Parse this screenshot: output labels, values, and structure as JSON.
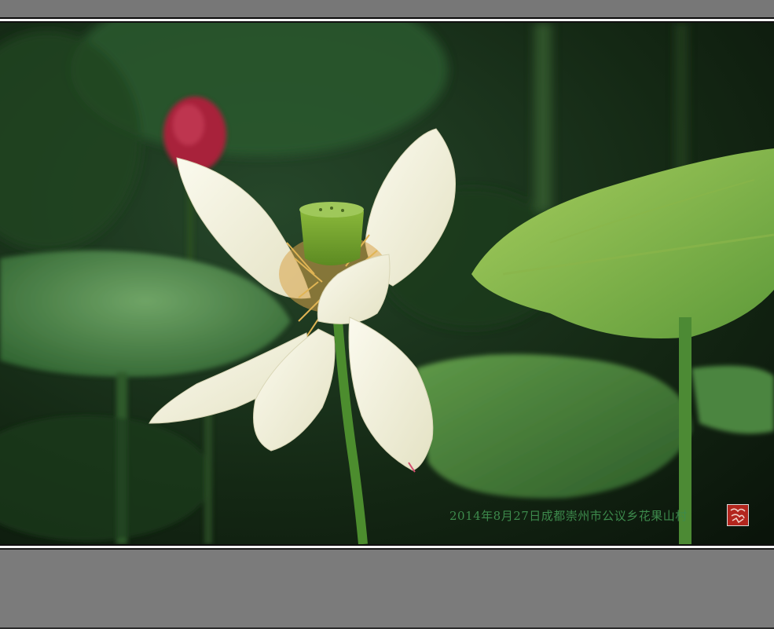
{
  "photo": {
    "caption": "2014年8月27日成都崇州市公议乡花果山村",
    "subject": "white-lotus-flower"
  },
  "colors": {
    "frame": "#7b7b7b",
    "background_dark": "#0e1a0e",
    "leaf_green": "#4e8f45",
    "petal_white": "#f3f1e2",
    "caption_green": "#3d8a4c",
    "seal_red": "#b3261e"
  }
}
